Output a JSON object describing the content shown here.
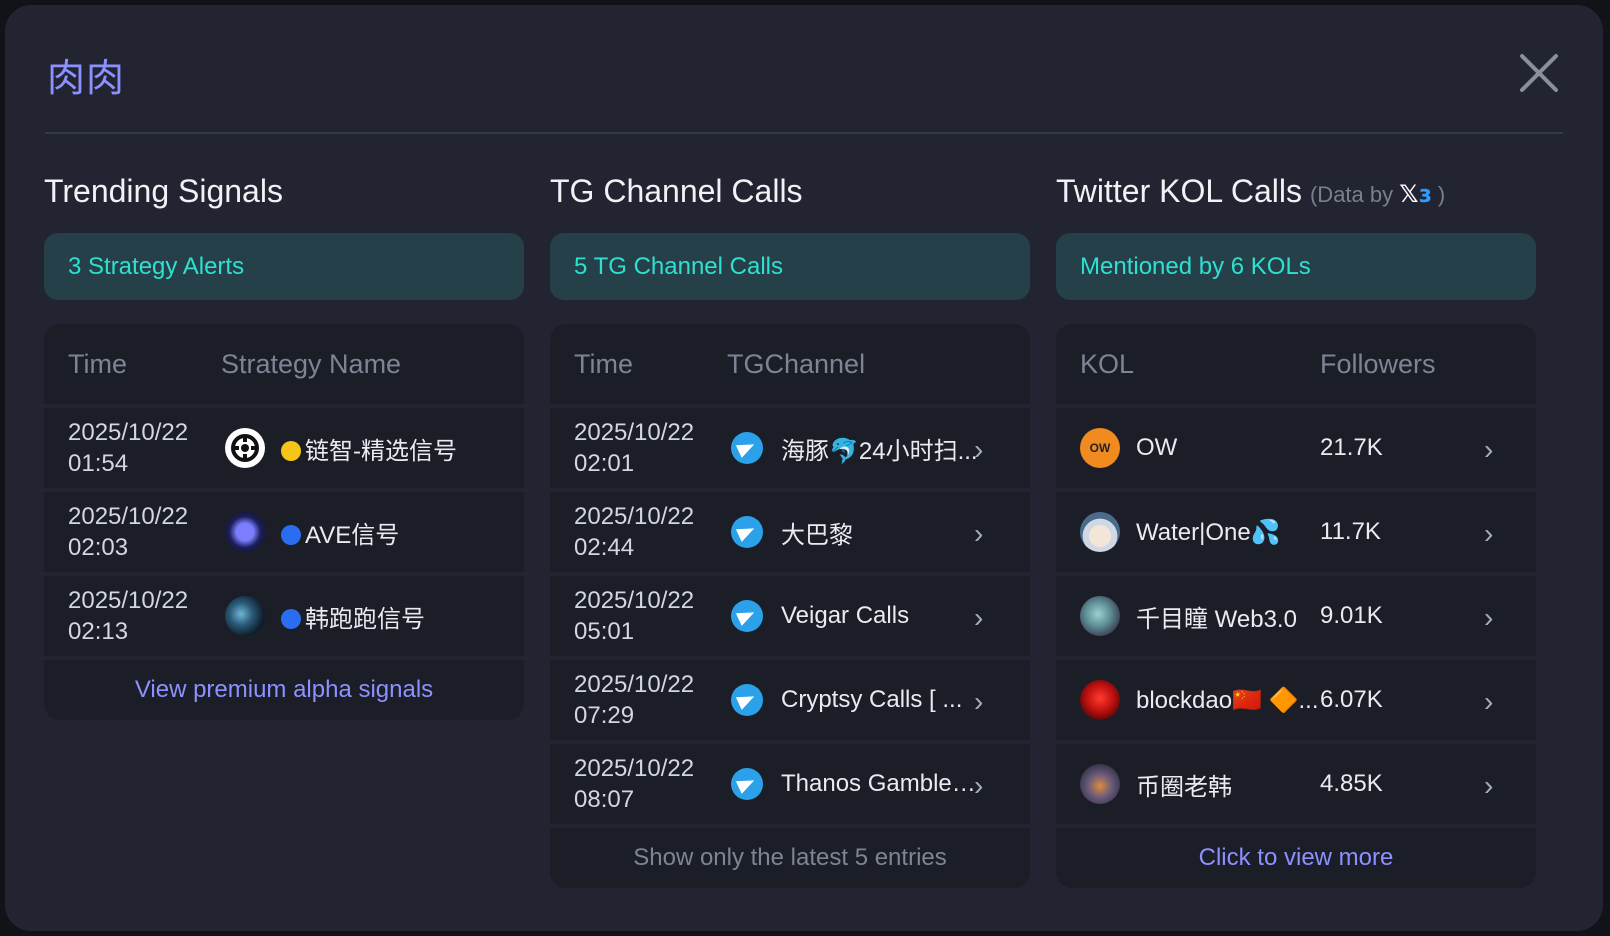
{
  "modal": {
    "title": "肉肉"
  },
  "trending": {
    "heading": "Trending Signals",
    "summary": "3 Strategy Alerts",
    "headers": [
      "Time",
      "Strategy Name"
    ],
    "rows": [
      {
        "date": "2025/10/22",
        "time": "01:54",
        "name": "链智-精选信号",
        "dot": "#f5c518"
      },
      {
        "date": "2025/10/22",
        "time": "02:03",
        "name": "AVE信号",
        "dot": "#2b6df0"
      },
      {
        "date": "2025/10/22",
        "time": "02:13",
        "name": "韩跑跑信号",
        "dot": "#2b6df0"
      }
    ],
    "footer": "View premium alpha signals"
  },
  "tg": {
    "heading": "TG Channel Calls",
    "summary": "5 TG Channel Calls",
    "headers": [
      "Time",
      "TGChannel"
    ],
    "rows": [
      {
        "date": "2025/10/22",
        "time": "02:01",
        "name": "海豚🐬24小时扫..."
      },
      {
        "date": "2025/10/22",
        "time": "02:44",
        "name": "大巴黎"
      },
      {
        "date": "2025/10/22",
        "time": "05:01",
        "name": "Veigar Calls"
      },
      {
        "date": "2025/10/22",
        "time": "07:29",
        "name": "Cryptsy Calls [ ..."
      },
      {
        "date": "2025/10/22",
        "time": "08:07",
        "name": "Thanos Gambles ?"
      }
    ],
    "footer": "Show only the latest 5 entries"
  },
  "twitter": {
    "heading": "Twitter KOL Calls",
    "data_by_open": "(Data by",
    "data_by_close": ")",
    "summary": "Mentioned by 6 KOLs",
    "headers": [
      "KOL",
      "Followers"
    ],
    "rows": [
      {
        "name": "OW",
        "followers": "21.7K"
      },
      {
        "name": "Water|One💦",
        "followers": "11.7K"
      },
      {
        "name": "千目瞳 Web3.0",
        "followers": "9.01K"
      },
      {
        "name": "blockdao🇨🇳 🔶...",
        "followers": "6.07K"
      },
      {
        "name": "币圈老韩",
        "followers": "4.85K"
      }
    ],
    "footer": "Click to view more"
  },
  "colors": {
    "accent": "#8c91ff",
    "teal": "#2fe0d0",
    "telegram": "#2aa1e8"
  },
  "icons": {
    "close": "close-icon",
    "chevron": "chevron-right-icon",
    "telegram": "telegram-icon"
  }
}
